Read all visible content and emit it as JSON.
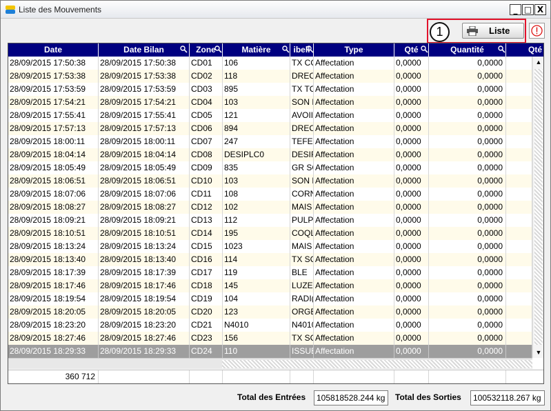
{
  "window": {
    "title": "Liste des Mouvements",
    "min": "_",
    "max": "□",
    "close": "X"
  },
  "toolbar": {
    "badge": "1",
    "liste_label": "Liste"
  },
  "grid": {
    "columns": [
      "Date",
      "Date Bilan",
      "Zone",
      "Matière",
      "ibell",
      "Type",
      "Qté",
      "Quantité",
      "Qté"
    ],
    "rows": [
      [
        "28/09/2015 17:50:38",
        "28/09/2015 17:50:38",
        "CD01",
        "106",
        "TX CC",
        "Affectation",
        "0,0000",
        "0,0000"
      ],
      [
        "28/09/2015 17:53:38",
        "28/09/2015 17:53:38",
        "CD02",
        "118",
        "DREC",
        "Affectation",
        "0,0000",
        "0,0000"
      ],
      [
        "28/09/2015 17:53:59",
        "28/09/2015 17:53:59",
        "CD03",
        "895",
        "TX TC",
        "Affectation",
        "0,0000",
        "0,0000"
      ],
      [
        "28/09/2015 17:54:21",
        "28/09/2015 17:54:21",
        "CD04",
        "103",
        "SON F",
        "Affectation",
        "0,0000",
        "0,0000"
      ],
      [
        "28/09/2015 17:55:41",
        "28/09/2015 17:55:41",
        "CD05",
        "121",
        "AVOII",
        "Affectation",
        "0,0000",
        "0,0000"
      ],
      [
        "28/09/2015 17:57:13",
        "28/09/2015 17:57:13",
        "CD06",
        "894",
        "DREC",
        "Affectation",
        "0,0000",
        "0,0000"
      ],
      [
        "28/09/2015 18:00:11",
        "28/09/2015 18:00:11",
        "CD07",
        "247",
        "TEFE",
        "Affectation",
        "0,0000",
        "0,0000"
      ],
      [
        "28/09/2015 18:04:14",
        "28/09/2015 18:04:14",
        "CD08",
        "DESIPLC0",
        "DESIF",
        "Affectation",
        "0,0000",
        "0,0000"
      ],
      [
        "28/09/2015 18:05:49",
        "28/09/2015 18:05:49",
        "CD09",
        "835",
        "GR SC",
        "Affectation",
        "0,0000",
        "0,0000"
      ],
      [
        "28/09/2015 18:06:51",
        "28/09/2015 18:06:51",
        "CD10",
        "103",
        "SON F",
        "Affectation",
        "0,0000",
        "0,0000"
      ],
      [
        "28/09/2015 18:07:06",
        "28/09/2015 18:07:06",
        "CD11",
        "108",
        "CORN",
        "Affectation",
        "0,0000",
        "0,0000"
      ],
      [
        "28/09/2015 18:08:27",
        "28/09/2015 18:08:27",
        "CD12",
        "102",
        "MAIS",
        "Affectation",
        "0,0000",
        "0,0000"
      ],
      [
        "28/09/2015 18:09:21",
        "28/09/2015 18:09:21",
        "CD13",
        "112",
        "PULPI",
        "Affectation",
        "0,0000",
        "0,0000"
      ],
      [
        "28/09/2015 18:10:51",
        "28/09/2015 18:10:51",
        "CD14",
        "195",
        "COQL",
        "Affectation",
        "0,0000",
        "0,0000"
      ],
      [
        "28/09/2015 18:13:24",
        "28/09/2015 18:13:24",
        "CD15",
        "1023",
        "MAIS",
        "Affectation",
        "0,0000",
        "0,0000"
      ],
      [
        "28/09/2015 18:13:40",
        "28/09/2015 18:13:40",
        "CD16",
        "114",
        "TX SC",
        "Affectation",
        "0,0000",
        "0,0000"
      ],
      [
        "28/09/2015 18:17:39",
        "28/09/2015 18:17:39",
        "CD17",
        "119",
        "BLE",
        "Affectation",
        "0,0000",
        "0,0000"
      ],
      [
        "28/09/2015 18:17:46",
        "28/09/2015 18:17:46",
        "CD18",
        "145",
        "LUZEI",
        "Affectation",
        "0,0000",
        "0,0000"
      ],
      [
        "28/09/2015 18:19:54",
        "28/09/2015 18:19:54",
        "CD19",
        "104",
        "RADI(",
        "Affectation",
        "0,0000",
        "0,0000"
      ],
      [
        "28/09/2015 18:20:05",
        "28/09/2015 18:20:05",
        "CD20",
        "123",
        "ORGE",
        "Affectation",
        "0,0000",
        "0,0000"
      ],
      [
        "28/09/2015 18:23:20",
        "28/09/2015 18:23:20",
        "CD21",
        "N4010",
        "N4010",
        "Affectation",
        "0,0000",
        "0,0000"
      ],
      [
        "28/09/2015 18:27:46",
        "28/09/2015 18:27:46",
        "CD23",
        "156",
        "TX SC",
        "Affectation",
        "0,0000",
        "0,0000"
      ],
      [
        "28/09/2015 18:29:33",
        "28/09/2015 18:29:33",
        "CD24",
        "110",
        "ISSUE",
        "Affectation",
        "0,0000",
        "0,0000"
      ]
    ],
    "selected_index": 22,
    "footer_count": "360 712"
  },
  "totals": {
    "entrees_label": "Total des Entrées",
    "entrees_value": "105818528.244 kg",
    "sorties_label": "Total des Sorties",
    "sorties_value": "100532118.267 kg"
  },
  "colors": {
    "header": "#000080",
    "highlight": "#e2112b",
    "alert": "#d11",
    "selected_row": "#9e9e9e",
    "even_row": "#fffbea"
  }
}
